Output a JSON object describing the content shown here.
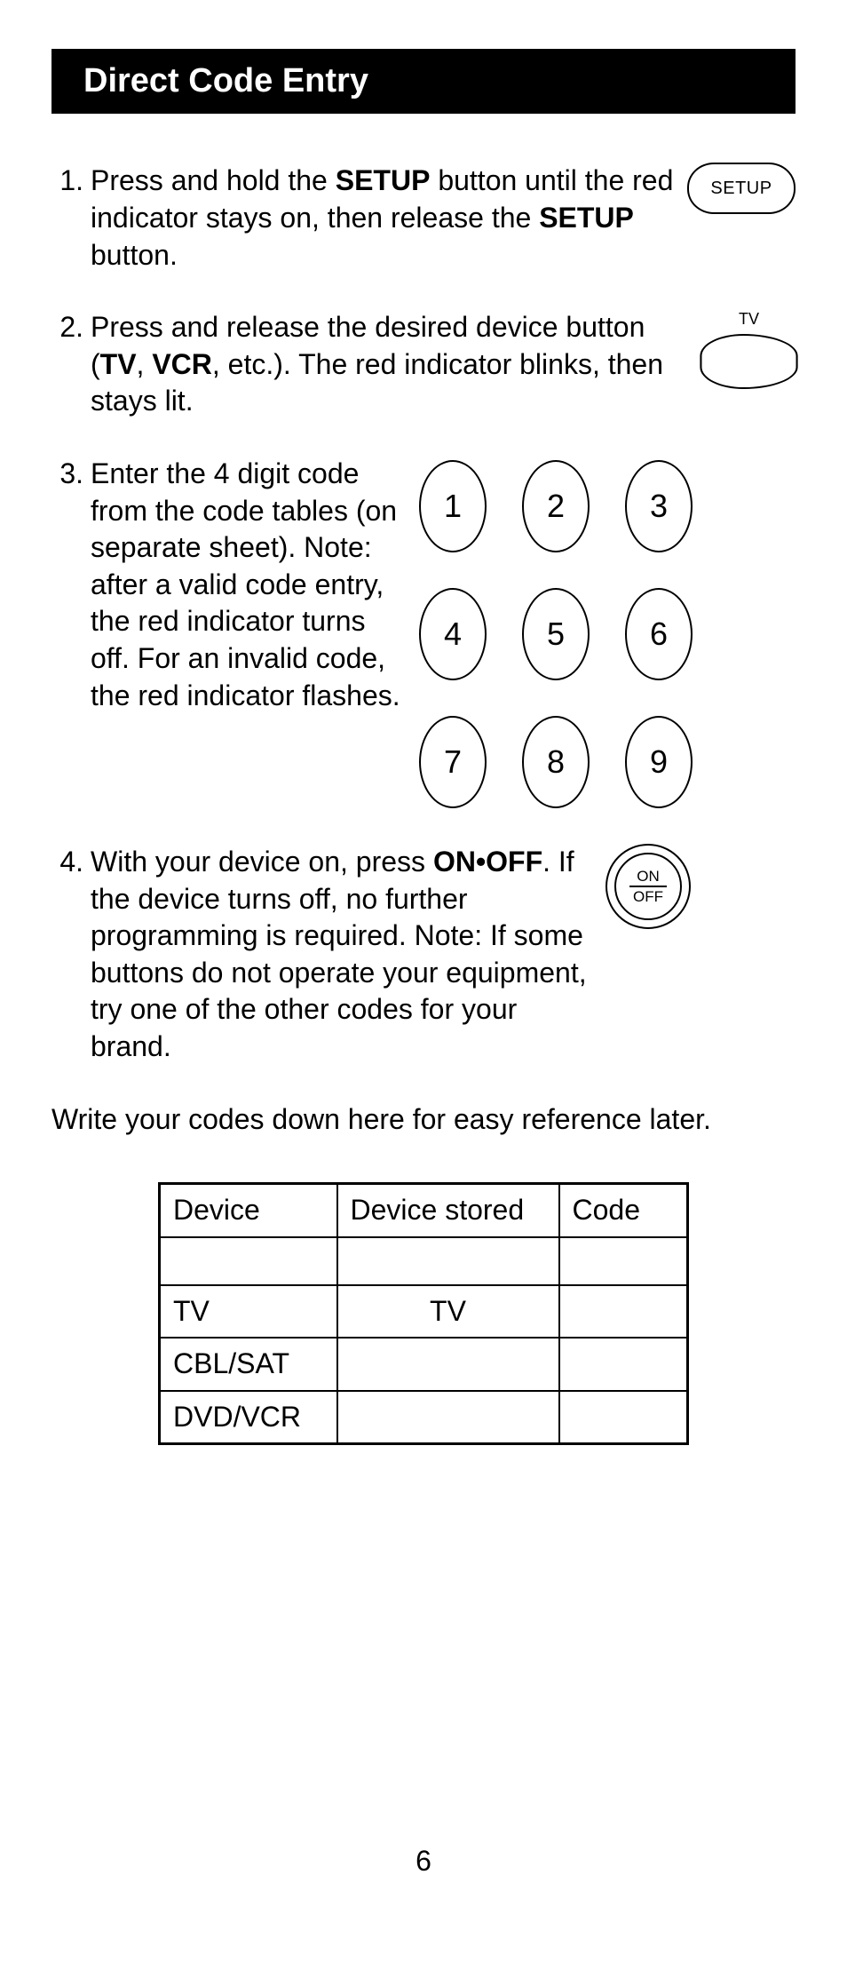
{
  "title": "Direct Code Entry",
  "steps": [
    {
      "num": "1.",
      "text_pre": "Press and hold the ",
      "bold1": "SETUP",
      "text_mid": " button until the red indicator stays on, then release the ",
      "bold2": "SETUP",
      "text_post": " button.",
      "icon": "setup",
      "setup_label": "SETUP"
    },
    {
      "num": "2.",
      "text_pre": "Press and release the desired device button (",
      "bold1": "TV",
      "text_sep": ", ",
      "bold2": "VCR",
      "text_post": ", etc.). The red indicator blinks, then stays lit.",
      "icon": "tv",
      "tv_label": "TV"
    },
    {
      "num": "3.",
      "text": "Enter the 4 digit code from the code tables (on separate sheet). Note: after a valid code entry, the red indicator turns off.  For an invalid code, the red indicator flashes.",
      "icon": "keypad",
      "keys": [
        "1",
        "2",
        "3",
        "4",
        "5",
        "6",
        "7",
        "8",
        "9"
      ]
    },
    {
      "num": "4.",
      "text_pre": "With your device on, press ",
      "bold1": "ON•OFF",
      "text_post": ". If the device turns off, no further programming is required. Note: If some buttons do not operate your equipment, try one of the other codes for your brand.",
      "icon": "onoff",
      "on_label": "ON",
      "off_label": "OFF"
    }
  ],
  "note": "Write your codes down here for easy reference later.",
  "table": {
    "headers": [
      "Device",
      "Device stored",
      "Code"
    ],
    "rows": [
      [
        "",
        "",
        ""
      ],
      [
        "TV",
        "TV",
        ""
      ],
      [
        "CBL/SAT",
        "",
        ""
      ],
      [
        "DVD/VCR",
        "",
        ""
      ]
    ]
  },
  "page_number": "6"
}
